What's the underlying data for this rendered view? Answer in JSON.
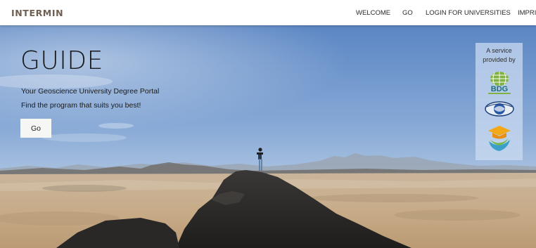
{
  "header": {
    "brand": "INTERMIN",
    "nav": [
      "WELCOME",
      "GO",
      "LOGIN FOR UNIVERSITIES",
      "IMPRINT"
    ]
  },
  "hero": {
    "title": "GUIDE",
    "tagline_1": "Your Geoscience University Degree Portal",
    "tagline_2": "Find the program that suits you best!",
    "cta_label": "Go"
  },
  "service_panel": {
    "line_1": "A service",
    "line_2": "provided by",
    "logos": [
      "bdg-logo",
      "globe-logo",
      "graduation-cap-logo"
    ],
    "bdg_text": "BDG"
  },
  "colors": {
    "brand": "#6e5f52",
    "sky_top": "#5b86c3",
    "sky_horizon": "#d6e1ea",
    "sand": "#cbb596",
    "rock": "#2b2a29",
    "panel": "#cdddf2"
  }
}
